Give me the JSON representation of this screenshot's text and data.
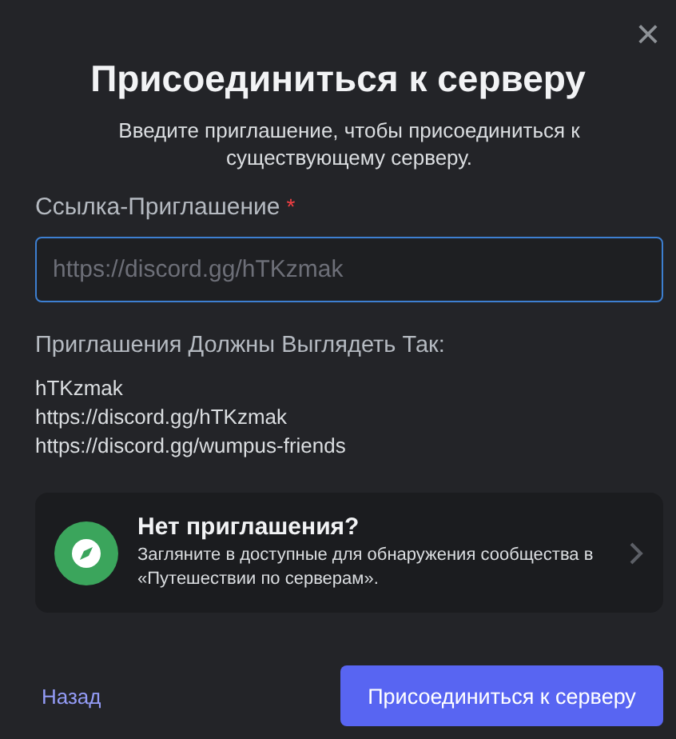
{
  "close_icon": "×",
  "title": "Присоединиться к серверу",
  "subtitle": "Введите приглашение, чтобы присоединиться к существующему серверу.",
  "invite_field": {
    "label": "Ссылка-Приглашение",
    "required_mark": "*",
    "placeholder": "https://discord.gg/hTKzmak",
    "focused": true
  },
  "examples": {
    "heading": "Приглашения Должны Выглядеть Так:",
    "lines": [
      "hTKzmak",
      "https://discord.gg/hTKzmak",
      "https://discord.gg/wumpus-friends"
    ]
  },
  "discover_card": {
    "title": "Нет приглашения?",
    "text": "Загляните в доступные для обнаружения сообщества в «Путешествии по серверам»."
  },
  "footer": {
    "back": "Назад",
    "submit": "Присоединиться к серверу"
  }
}
